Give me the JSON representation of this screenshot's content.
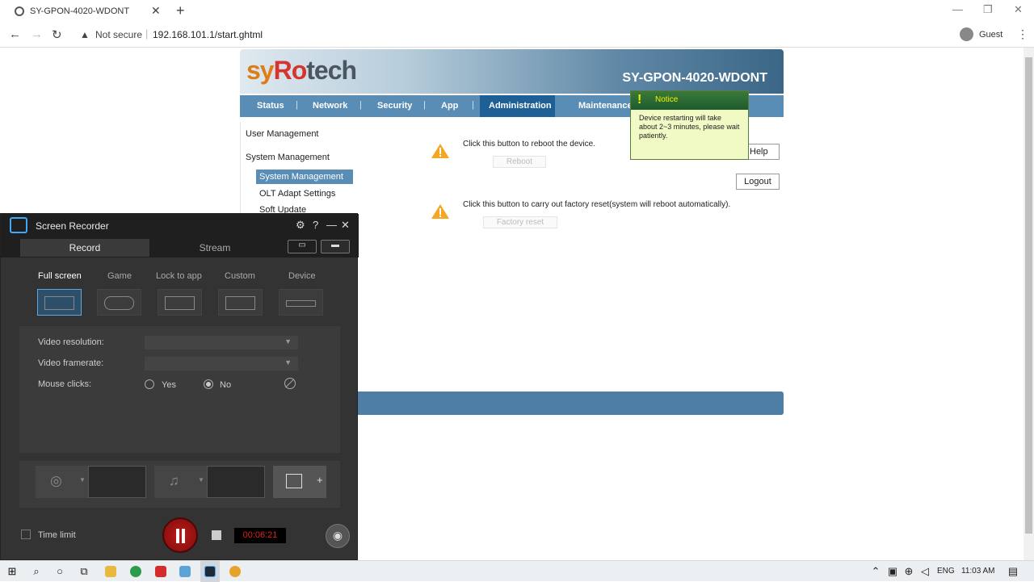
{
  "browser": {
    "tab_title": "SY-GPON-4020-WDONT",
    "not_secure": "Not secure",
    "url": "192.168.101.1/start.ghtml",
    "profile": "Guest"
  },
  "router": {
    "logo_sy": "sy",
    "logo_ro": "Ro",
    "logo_tech": "tech",
    "model": "SY-GPON-4020-WDONT",
    "nav": [
      "Status",
      "Network",
      "Security",
      "App",
      "Administration",
      "Maintenance"
    ],
    "active_nav": "Administration",
    "sidebar": {
      "user_management": "User Management",
      "system_management": "System Management",
      "sub_selected": "System Management",
      "sub_olt": "OLT Adapt Settings",
      "sub_soft_update": "Soft Update"
    },
    "reboot_text": "Click this button to reboot the device.",
    "reboot_button": "Reboot",
    "reset_text": "Click this button to carry out factory reset(system will reboot automatically).",
    "reset_button": "Factory reset",
    "help_button": "Help",
    "logout_button": "Logout",
    "notice": {
      "title": "Notice",
      "body": "Device restarting will take about 2~3 minutes, please wait patiently."
    }
  },
  "recorder": {
    "title": "Screen Recorder",
    "tab_record": "Record",
    "tab_stream": "Stream",
    "modes": [
      "Full screen",
      "Game",
      "Lock to app",
      "Custom",
      "Device"
    ],
    "selected_mode": "Full screen",
    "video_resolution_label": "Video resolution:",
    "video_framerate_label": "Video framerate:",
    "mouse_clicks_label": "Mouse clicks:",
    "mouse_yes": "Yes",
    "mouse_no": "No",
    "mouse_clicks_value": "No",
    "time_limit": "Time limit",
    "timer": "00:06:21"
  },
  "taskbar": {
    "language": "ENG",
    "time": "11:03 AM"
  },
  "colors": {
    "nav_bg": "#5a8db5",
    "nav_active": "#1e5f95",
    "recorder_bg": "#333333",
    "record_red": "#c21818"
  }
}
